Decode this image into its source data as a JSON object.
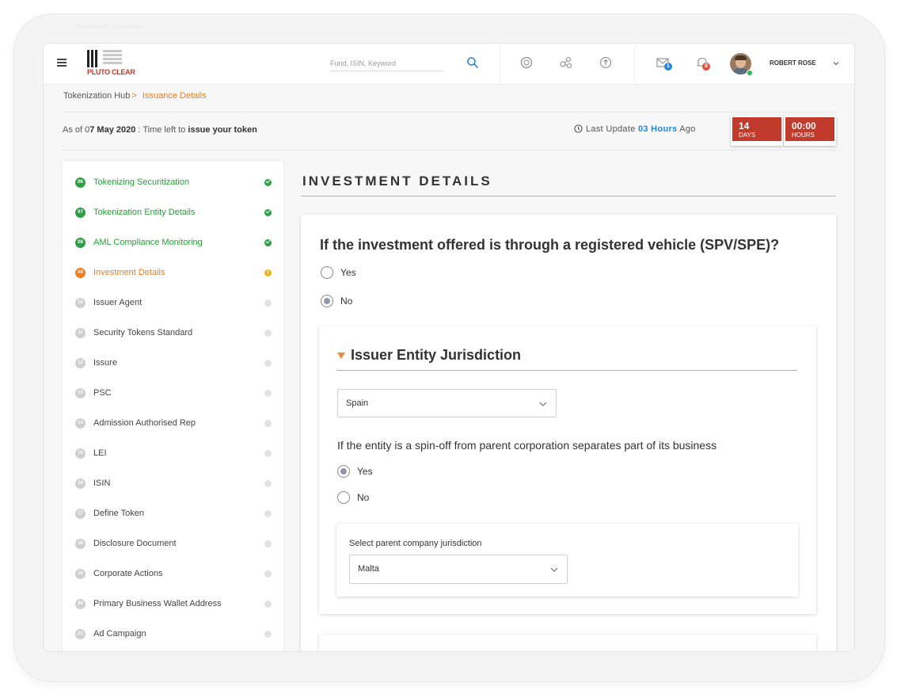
{
  "brand": {
    "logo_text": "PLUTO CLEAR"
  },
  "topbar": {
    "search_placeholder": "Fund, ISIN, Keyword",
    "mail_badge": "1",
    "notif_badge": "8",
    "user_name": "ROBERT ROSE",
    "colors": {
      "mail_badge": "#1e88e5",
      "notif_badge": "#e74c3c"
    }
  },
  "breadcrumb": {
    "root": "Tokenization Hub",
    "separator": ">",
    "current": "Issuance Details"
  },
  "status": {
    "as_of_prefix": "As of 0",
    "as_of_date": "7 May 2020",
    "as_of_middle": " : Time left to ",
    "as_of_action": "issue your token",
    "last_update_prefix": "Last Update",
    "last_update_value": "03 Hours",
    "last_update_suffix": "Ago",
    "countdown": [
      {
        "value": "14",
        "unit": "DAYS"
      },
      {
        "value": "00:00",
        "unit": "HOURS"
      }
    ]
  },
  "steps": [
    {
      "num": "06",
      "label": "Tokenizing Securitization",
      "state": "done"
    },
    {
      "num": "07",
      "label": "Tokenization Entity Details",
      "state": "done"
    },
    {
      "num": "08",
      "label": "AML Compliance Monitoring",
      "state": "done"
    },
    {
      "num": "09",
      "label": "Investment Details",
      "state": "current"
    },
    {
      "num": "10",
      "label": "Issuer Agent",
      "state": "pending"
    },
    {
      "num": "11",
      "label": "Security Tokens Standard",
      "state": "pending"
    },
    {
      "num": "12",
      "label": "Issure",
      "state": "pending"
    },
    {
      "num": "13",
      "label": "PSC",
      "state": "pending"
    },
    {
      "num": "14",
      "label": "Admission Authorised Rep",
      "state": "pending"
    },
    {
      "num": "15",
      "label": "LEI",
      "state": "pending"
    },
    {
      "num": "16",
      "label": "ISIN",
      "state": "pending"
    },
    {
      "num": "17",
      "label": "Define Token",
      "state": "pending"
    },
    {
      "num": "18",
      "label": "Disclosure Document",
      "state": "pending"
    },
    {
      "num": "19",
      "label": "Corporate Actions",
      "state": "pending"
    },
    {
      "num": "20",
      "label": "Primary Business Wallet Address",
      "state": "pending"
    },
    {
      "num": "21",
      "label": "Ad Campaign",
      "state": "pending"
    }
  ],
  "main": {
    "section_title": "INVESTMENT DETAILS",
    "question": "If the investment offered is through a registered vehicle (SPV/SPE)?",
    "vehicle_options": [
      {
        "label": "Yes",
        "checked": false
      },
      {
        "label": "No",
        "checked": true
      }
    ],
    "jurisdiction": {
      "title": "Issuer Entity Jurisdiction",
      "selected": "Spain",
      "spinoff_question": "If the entity is a spin-off from parent corporation separates part of its business",
      "spinoff_options": [
        {
          "label": "Yes",
          "checked": true
        },
        {
          "label": "No",
          "checked": false
        }
      ],
      "parent_label": "Select parent company jurisdiction",
      "parent_selected": "Malta"
    }
  }
}
